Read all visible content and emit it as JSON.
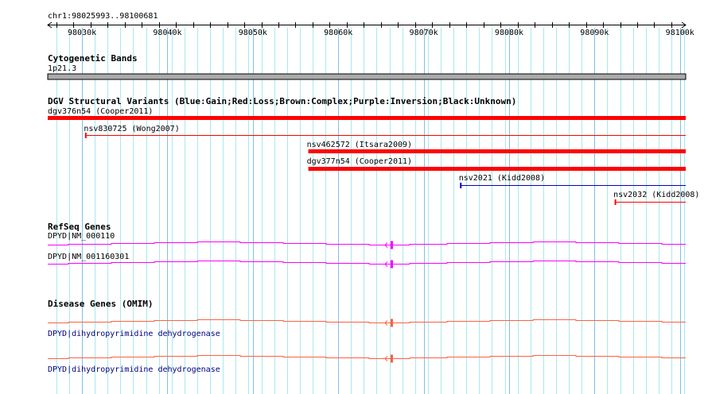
{
  "ruler": {
    "region": "chr1:98025993..98100681",
    "start": 98025993,
    "end": 98100681,
    "ticks": [
      "98030k",
      "98040k",
      "98050k",
      "98060k",
      "98070k",
      "98080k",
      "98090k",
      "98100k"
    ]
  },
  "cyto": {
    "title": "Cytogenetic Bands",
    "band": "1p21.3"
  },
  "dgv": {
    "title": "DGV Structural Variants (Blue:Gain;Red:Loss;Brown:Complex;Purple:Inversion;Black:Unknown)",
    "items": [
      {
        "label": "dgv376n54 (Cooper2011)",
        "start": 98025993,
        "end": 98100681,
        "color": "#ff0000",
        "thick": true
      },
      {
        "label": "nsv830725 (Wong2007)",
        "start": 98030400,
        "end": 98100681,
        "color": "#ff0000",
        "thick": false
      },
      {
        "label": "nsv462572 (Itsara2009)",
        "start": 98056500,
        "end": 98100681,
        "color": "#ff0000",
        "thick": true
      },
      {
        "label": "dgv377n54 (Cooper2011)",
        "start": 98056500,
        "end": 98100681,
        "color": "#ff0000",
        "thick": true
      },
      {
        "label": "nsv2021 (Kidd2008)",
        "start": 98074300,
        "end": 98100681,
        "color": "#0000cc",
        "thick": false
      },
      {
        "label": "nsv2032 (Kidd2008)",
        "start": 98092400,
        "end": 98100681,
        "color": "#ff0000",
        "thick": false
      }
    ]
  },
  "refseq": {
    "title": "RefSeq Genes",
    "color": "#ff00ff",
    "genes": [
      "DPYD|NM_000110",
      "DPYD|NM_001160301"
    ]
  },
  "omim": {
    "title": "Disease Genes (OMIM)",
    "color": "#ff6040",
    "genes": [
      "DPYD|dihydropyrimidine dehydrogenase",
      "DPYD|dihydropyrimidine dehydrogenase"
    ]
  }
}
